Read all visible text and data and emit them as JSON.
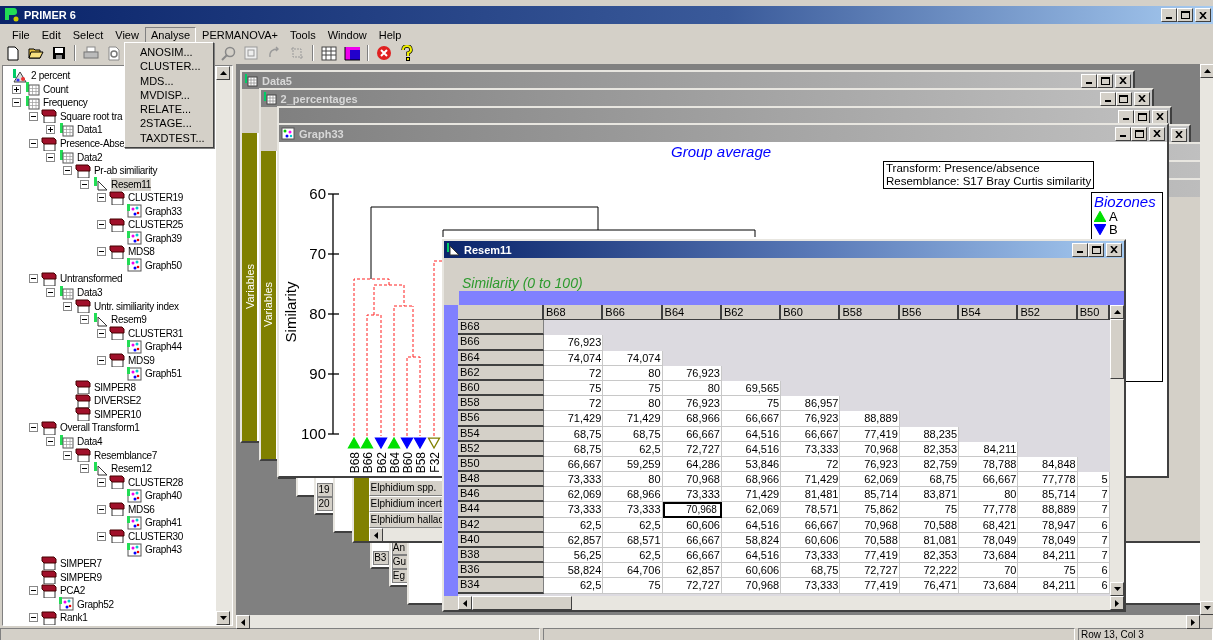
{
  "app": {
    "title": "PRIMER 6",
    "active": true
  },
  "menu": [
    {
      "label": "File",
      "selected": false
    },
    {
      "label": "Edit",
      "selected": false
    },
    {
      "label": "Select",
      "selected": false
    },
    {
      "label": "View",
      "selected": false
    },
    {
      "label": "Analyse",
      "selected": true
    },
    {
      "label": "PERMANOVA+",
      "selected": false
    },
    {
      "label": "Tools",
      "selected": false
    },
    {
      "label": "Window",
      "selected": false
    },
    {
      "label": "Help",
      "selected": false
    }
  ],
  "dropdown": [
    "ANOSIM...",
    "CLUSTER...",
    "MDS...",
    "MVDISP...",
    "RELATE...",
    "2STAGE...",
    "TAXDTEST..."
  ],
  "tree": {
    "items": [
      {
        "label": "2 percent",
        "kind": "workspace",
        "selected": false,
        "children": [
          {
            "label": "Count",
            "kind": "data",
            "expanded": false,
            "selected": false
          },
          {
            "label": "Frequency",
            "kind": "data",
            "expanded": true,
            "selected": false,
            "children": [
              {
                "label": "Square root tra",
                "kind": "results",
                "expanded": true,
                "selected": false,
                "children": [
                  {
                    "label": "Data1",
                    "kind": "data",
                    "expanded": false,
                    "selected": false
                  }
                ]
              },
              {
                "label": "Presence-Abse",
                "kind": "results",
                "expanded": true,
                "selected": false,
                "children": [
                  {
                    "label": "Data2",
                    "kind": "data",
                    "expanded": true,
                    "selected": false,
                    "children": [
                      {
                        "label": "Pr-ab similiarity",
                        "kind": "results",
                        "expanded": true,
                        "selected": false,
                        "children": [
                          {
                            "label": "Resem11",
                            "kind": "resemblance",
                            "expanded": true,
                            "selected": true,
                            "children": [
                              {
                                "label": "CLUSTER19",
                                "kind": "results",
                                "expanded": true,
                                "selected": false,
                                "children": [
                                  {
                                    "label": "Graph33",
                                    "kind": "graph",
                                    "selected": false
                                  }
                                ]
                              },
                              {
                                "label": "CLUSTER25",
                                "kind": "results",
                                "expanded": true,
                                "selected": false,
                                "children": [
                                  {
                                    "label": "Graph39",
                                    "kind": "graph",
                                    "selected": false
                                  }
                                ]
                              },
                              {
                                "label": "MDS8",
                                "kind": "results",
                                "expanded": true,
                                "selected": false,
                                "children": [
                                  {
                                    "label": "Graph50",
                                    "kind": "graph",
                                    "selected": false
                                  }
                                ]
                              }
                            ]
                          }
                        ]
                      }
                    ]
                  }
                ]
              },
              {
                "label": "Untransformed",
                "kind": "results",
                "expanded": true,
                "selected": false,
                "children": [
                  {
                    "label": "Data3",
                    "kind": "data",
                    "expanded": true,
                    "selected": false,
                    "children": [
                      {
                        "label": "Untr. similiarity index",
                        "kind": "results",
                        "expanded": true,
                        "selected": false,
                        "children": [
                          {
                            "label": "Resem9",
                            "kind": "resemblance",
                            "expanded": true,
                            "selected": false,
                            "children": [
                              {
                                "label": "CLUSTER31",
                                "kind": "results",
                                "expanded": true,
                                "selected": false,
                                "children": [
                                  {
                                    "label": "Graph44",
                                    "kind": "graph",
                                    "selected": false
                                  }
                                ]
                              },
                              {
                                "label": "MDS9",
                                "kind": "results",
                                "expanded": true,
                                "selected": false,
                                "children": [
                                  {
                                    "label": "Graph51",
                                    "kind": "graph",
                                    "selected": false
                                  }
                                ]
                              }
                            ]
                          }
                        ]
                      },
                      {
                        "label": "SIMPER8",
                        "kind": "results",
                        "selected": false
                      },
                      {
                        "label": "DIVERSE2",
                        "kind": "results",
                        "selected": false
                      },
                      {
                        "label": "SIMPER10",
                        "kind": "results",
                        "selected": false
                      }
                    ]
                  }
                ]
              },
              {
                "label": "Overall Transform1",
                "kind": "results",
                "expanded": true,
                "selected": false,
                "children": [
                  {
                    "label": "Data4",
                    "kind": "data",
                    "expanded": true,
                    "selected": false,
                    "children": [
                      {
                        "label": "Resemblance7",
                        "kind": "results",
                        "expanded": true,
                        "selected": false,
                        "children": [
                          {
                            "label": "Resem12",
                            "kind": "resemblance",
                            "expanded": true,
                            "selected": false,
                            "children": [
                              {
                                "label": "CLUSTER28",
                                "kind": "results",
                                "expanded": true,
                                "selected": false,
                                "children": [
                                  {
                                    "label": "Graph40",
                                    "kind": "graph",
                                    "selected": false
                                  }
                                ]
                              },
                              {
                                "label": "MDS6",
                                "kind": "results",
                                "expanded": true,
                                "selected": false,
                                "children": [
                                  {
                                    "label": "Graph41",
                                    "kind": "graph",
                                    "selected": false
                                  }
                                ]
                              },
                              {
                                "label": "CLUSTER30",
                                "kind": "results",
                                "expanded": true,
                                "selected": false,
                                "children": [
                                  {
                                    "label": "Graph43",
                                    "kind": "graph",
                                    "selected": false
                                  }
                                ]
                              }
                            ]
                          }
                        ]
                      }
                    ]
                  }
                ]
              },
              {
                "label": "SIMPER7",
                "kind": "results",
                "selected": false
              },
              {
                "label": "SIMPER9",
                "kind": "results",
                "selected": false
              },
              {
                "label": "PCA2",
                "kind": "results",
                "expanded": true,
                "selected": false,
                "children": [
                  {
                    "label": "Graph52",
                    "kind": "graph",
                    "selected": false
                  }
                ]
              },
              {
                "label": "Rank1",
                "kind": "results",
                "expanded": true,
                "selected": false
              }
            ]
          }
        ]
      }
    ]
  },
  "windows": [
    {
      "title": "Data5",
      "active": false,
      "kind": "sheet",
      "sidebar": "Variables"
    },
    {
      "title": "2_percentages",
      "active": false,
      "kind": "sheet",
      "sidebar": "Variables"
    },
    {
      "kind": "blank"
    },
    {
      "kind": "blank"
    },
    {
      "kind": "cells",
      "cells": [
        "19",
        "20"
      ]
    },
    {
      "kind": "blank"
    },
    {
      "kind": "sheet",
      "cells": [
        "Elphidium spp.",
        "Elphidium incert",
        "Elphidium hallac"
      ]
    },
    {
      "kind": "cells",
      "cells": [
        "B3"
      ]
    },
    {
      "kind": "cells",
      "cells": [
        "An",
        "Gu",
        "Eg"
      ]
    },
    {
      "kind": "blank"
    }
  ],
  "graph_window": {
    "title": "Graph33",
    "active": false,
    "graph_title": "Group average",
    "info": [
      "Transform: Presence/absence",
      "Resemblance: S17 Bray Curtis similarity"
    ],
    "y_axis": {
      "label": "Similarity",
      "ticks": [
        "60",
        "70",
        "80",
        "90",
        "100"
      ]
    },
    "leaves": [
      {
        "label": "B68",
        "kind": "up",
        "color": "#00e000"
      },
      {
        "label": "B66",
        "kind": "up",
        "color": "#00e000"
      },
      {
        "label": "B62",
        "kind": "down",
        "color": "#0000ff"
      },
      {
        "label": "B64",
        "kind": "up",
        "color": "#00e000"
      },
      {
        "label": "B60",
        "kind": "down",
        "color": "#0000ff"
      },
      {
        "label": "B58",
        "kind": "down",
        "color": "#0000ff"
      },
      {
        "label": "F32",
        "kind": "down-open",
        "color": "#808000"
      }
    ],
    "legend": {
      "title": "Biozones",
      "items": [
        {
          "label": "A",
          "kind": "up",
          "color": "#00e000"
        },
        {
          "label": "B",
          "kind": "down",
          "color": "#0000ff"
        }
      ]
    }
  },
  "matrix_window": {
    "title": "Resem11",
    "active": true,
    "caption": "Similarity (0 to 100)",
    "columns": [
      {
        "label": "B68",
        "selected": false
      },
      {
        "label": "B66",
        "selected": false
      },
      {
        "label": "B64",
        "selected": true
      },
      {
        "label": "B62",
        "selected": false
      },
      {
        "label": "B60",
        "selected": false
      },
      {
        "label": "B58",
        "selected": false
      },
      {
        "label": "B56",
        "selected": false
      },
      {
        "label": "B54",
        "selected": false
      },
      {
        "label": "B52",
        "selected": false
      },
      {
        "label": "B50",
        "selected": false
      }
    ],
    "rows": [
      {
        "label": "B68",
        "selected": false,
        "values": []
      },
      {
        "label": "B66",
        "selected": false,
        "values": [
          "76,923"
        ]
      },
      {
        "label": "B64",
        "selected": false,
        "values": [
          "74,074",
          "74,074"
        ]
      },
      {
        "label": "B62",
        "selected": false,
        "values": [
          "72",
          "80",
          "76,923"
        ]
      },
      {
        "label": "B60",
        "selected": false,
        "values": [
          "75",
          "75",
          "80",
          "69,565"
        ]
      },
      {
        "label": "B58",
        "selected": false,
        "values": [
          "72",
          "80",
          "76,923",
          "75",
          "86,957"
        ]
      },
      {
        "label": "B56",
        "selected": false,
        "values": [
          "71,429",
          "71,429",
          "68,966",
          "66,667",
          "76,923",
          "88,889"
        ]
      },
      {
        "label": "B54",
        "selected": false,
        "values": [
          "68,75",
          "68,75",
          "66,667",
          "64,516",
          "66,667",
          "77,419",
          "88,235"
        ]
      },
      {
        "label": "B52",
        "selected": false,
        "values": [
          "68,75",
          "62,5",
          "72,727",
          "64,516",
          "73,333",
          "70,968",
          "82,353",
          "84,211"
        ]
      },
      {
        "label": "B50",
        "selected": false,
        "values": [
          "66,667",
          "59,259",
          "64,286",
          "53,846",
          "72",
          "76,923",
          "82,759",
          "78,788",
          "84,848"
        ]
      },
      {
        "label": "B48",
        "selected": false,
        "values": [
          "73,333",
          "80",
          "70,968",
          "68,966",
          "71,429",
          "62,069",
          "68,75",
          "66,667",
          "77,778",
          "5"
        ]
      },
      {
        "label": "B46",
        "selected": false,
        "values": [
          "62,069",
          "68,966",
          "73,333",
          "71,429",
          "81,481",
          "85,714",
          "83,871",
          "80",
          "85,714",
          "7"
        ]
      },
      {
        "label": "B44",
        "selected": true,
        "values": [
          "73,333",
          "73,333",
          "70,968",
          "62,069",
          "78,571",
          "75,862",
          "75",
          "77,778",
          "88,889",
          "7"
        ]
      },
      {
        "label": "B42",
        "selected": false,
        "values": [
          "62,5",
          "62,5",
          "60,606",
          "64,516",
          "66,667",
          "70,968",
          "70,588",
          "68,421",
          "78,947",
          "6"
        ]
      },
      {
        "label": "B40",
        "selected": false,
        "values": [
          "62,857",
          "68,571",
          "66,667",
          "58,824",
          "60,606",
          "70,588",
          "81,081",
          "78,049",
          "78,049",
          "7"
        ]
      },
      {
        "label": "B38",
        "selected": false,
        "values": [
          "56,25",
          "62,5",
          "66,667",
          "64,516",
          "73,333",
          "77,419",
          "82,353",
          "73,684",
          "84,211",
          "7"
        ]
      },
      {
        "label": "B36",
        "selected": false,
        "values": [
          "58,824",
          "64,706",
          "62,857",
          "60,606",
          "68,75",
          "72,727",
          "72,222",
          "70",
          "75",
          "6"
        ]
      },
      {
        "label": "B34",
        "selected": false,
        "values": [
          "62,5",
          "75",
          "72,727",
          "70,968",
          "73,333",
          "77,419",
          "76,471",
          "73,684",
          "84,211",
          "6"
        ]
      }
    ]
  },
  "status_bar": {
    "position": "Row 13, Col 3"
  }
}
